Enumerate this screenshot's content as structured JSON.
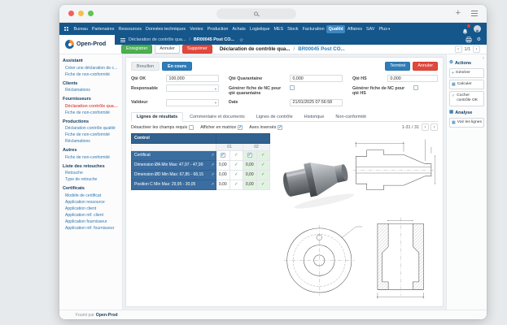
{
  "icons": {
    "plus": "+",
    "star": "☆",
    "gear": "⚙",
    "check": "✓",
    "prev": "‹",
    "next": "›",
    "caret": "▾",
    "grid": "▦",
    "external": "↗"
  },
  "nav": {
    "items": [
      "Bureau",
      "Partenaires",
      "Ressources",
      "Données techniques",
      "Ventes",
      "Production",
      "Achats",
      "Logistique",
      "MES",
      "Stock",
      "Facturation",
      "Qualité",
      "Affaires",
      "SAV",
      "Plus"
    ],
    "active_item": "Qualité"
  },
  "brand": {
    "name": "Open-Prod"
  },
  "breadcrumb": {
    "parent": "Déclaration de contrôle qua...",
    "separator": "/",
    "current": "BR00045 Post CO..."
  },
  "titlebar": {
    "save": "Enregistrer",
    "discard": "Annuler",
    "delete": "Supprimer",
    "title": "Déclaration de contrôle qua...",
    "separator": "/",
    "record": "BR00045 Post CO...",
    "pager": "1/1"
  },
  "status": {
    "draft": "Brouillon",
    "in_progress": "En cours",
    "done_action": "Terminé",
    "cancel_action": "Annuler"
  },
  "form": {
    "qty_ok_label": "Qté OK",
    "qty_ok_value": "100,000",
    "qty_quarantine_label": "Qté Quarantaine",
    "qty_quarantine_value": "0,000",
    "qty_hs_label": "Qté HS",
    "qty_hs_value": "0,000",
    "responsible_label": "Responsable",
    "responsible_value": "",
    "validator_label": "Valideur",
    "validator_value": "",
    "gen_nc_quarantine_label": "Générer fiche de NC pour qté quarantaine",
    "gen_nc_hs_label": "Générer fiche de NC pour qté HS",
    "date_label": "Date",
    "date_value": "21/01/2025 07:56:58"
  },
  "tabs": [
    "Lignes de résultats",
    "Commentaire et documents",
    "Lignes de contrôle",
    "Historique",
    "Non-conformité"
  ],
  "options": {
    "disable_required": "Désactiver les champs requis",
    "matrix_view": "Afficher en matrice",
    "inverted_axes": "Axes inversés",
    "pager": "1-31 / 31"
  },
  "matrix": {
    "corner": "Control",
    "columns": [
      "01",
      "02"
    ],
    "rows": [
      {
        "label": "Certificat",
        "values": [
          "",
          ""
        ]
      },
      {
        "label": "Dimension ØA Min Max: 47,97 - 47,99",
        "values": [
          "0,00",
          "0,00"
        ]
      },
      {
        "label": "Dimension ØD Min Max: 67,85 - 68,15",
        "values": [
          "0,00",
          "0,00"
        ]
      },
      {
        "label": "Position C Min Max: 29,95 - 30,05",
        "values": [
          "0,00",
          "0,00"
        ]
      }
    ]
  },
  "actions_panel": {
    "title": "Actions",
    "generate": "Générer",
    "calculate": "Calculer",
    "check_ok": "Cocher contrôle OK",
    "analysis_title": "Analyse",
    "view_lines": "Voir les lignes"
  },
  "sidebar": {
    "sections": [
      {
        "title": "Assistant",
        "items": [
          {
            "label": "Créer une déclaration de c..."
          },
          {
            "label": "Fiche de non-conformité"
          }
        ]
      },
      {
        "title": "Clients",
        "items": [
          {
            "label": "Réclamations"
          }
        ]
      },
      {
        "title": "Fournisseurs",
        "items": [
          {
            "label": "Déclaration contrôle qualité"
          },
          {
            "label": "Fiche de non-conformité"
          }
        ]
      },
      {
        "title": "Productions",
        "items": [
          {
            "label": "Déclaration contrôle qualité"
          },
          {
            "label": "Fiche de non-conformité"
          },
          {
            "label": "Réclamations"
          }
        ]
      },
      {
        "title": "Autres",
        "items": [
          {
            "label": "Fiche de non-conformité"
          }
        ]
      },
      {
        "title": "Liste des retouches",
        "items": [
          {
            "label": "Retouche"
          },
          {
            "label": "Type de retouche"
          }
        ]
      },
      {
        "title": "Certificats",
        "items": [
          {
            "label": "Modèle de certificat"
          },
          {
            "label": "Application ressource"
          },
          {
            "label": "Application client"
          },
          {
            "label": "Application réf. client"
          },
          {
            "label": "Application fournisseur"
          },
          {
            "label": "Application réf. fournisseur"
          }
        ]
      }
    ]
  },
  "footer": {
    "prefix": "Fourni par",
    "brand": "Open-Prod"
  },
  "colors": {
    "topbar": "#15568b",
    "menu_active": "#3c87c0",
    "primary": "#2e7cb8",
    "success": "#4caf50",
    "danger": "#e0493e",
    "link": "#2f77ad",
    "active_sidebar_item": "#e2574c"
  }
}
